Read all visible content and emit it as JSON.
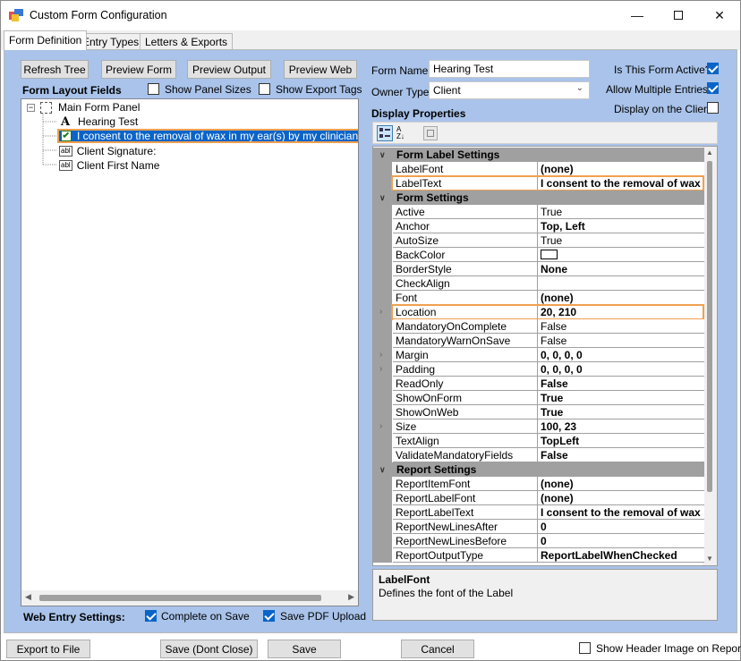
{
  "window": {
    "title": "Custom Form Configuration"
  },
  "tabs": [
    "Form Definition",
    "Entry Types",
    "Letters & Exports"
  ],
  "toolbar": {
    "refresh_tree": "Refresh Tree",
    "preview_form": "Preview Form",
    "preview_output": "Preview Output",
    "preview_web": "Preview Web"
  },
  "layout": {
    "heading": "Form Layout Fields",
    "show_panel_sizes": "Show Panel Sizes",
    "show_export_tags": "Show Export Tags",
    "tree": [
      {
        "label": "Main Form Panel",
        "icon": "panel-icon"
      },
      {
        "label": "Hearing Test",
        "icon": "label-a-icon"
      },
      {
        "label": "I consent to the removal of wax in my ear(s) by my clinician (if applic",
        "icon": "checkbox-icon"
      },
      {
        "label": "Client Signature:",
        "icon": "textbox-icon"
      },
      {
        "label": "Client First Name",
        "icon": "textbox-icon"
      }
    ]
  },
  "form": {
    "name_label": "Form Name",
    "name_value": "Hearing Test",
    "owner_label": "Owner Type",
    "owner_value": "Client",
    "active_label": "Is This Form Active?",
    "active": true,
    "multiple_label": "Allow Multiple Entries?",
    "multiple": true,
    "client_label": "Display on the Client",
    "client": false
  },
  "display": {
    "heading": "Display Properties",
    "props": [
      {
        "type": "cat",
        "name": "Form Label Settings"
      },
      {
        "name": "LabelFont",
        "value": "(none)",
        "bold": true
      },
      {
        "name": "LabelText",
        "value": "I consent to the removal of wax",
        "bold": true
      },
      {
        "type": "cat",
        "name": "Form Settings"
      },
      {
        "name": "Active",
        "value": "True"
      },
      {
        "name": "Anchor",
        "value": "Top, Left",
        "bold": true
      },
      {
        "name": "AutoSize",
        "value": "True"
      },
      {
        "name": "BackColor",
        "value": "",
        "swatch": "#ffffff"
      },
      {
        "name": "BorderStyle",
        "value": "None",
        "bold": true
      },
      {
        "name": "CheckAlign",
        "value": ""
      },
      {
        "name": "Font",
        "value": "(none)",
        "bold": true
      },
      {
        "name": "Location",
        "value": "20, 210",
        "bold": true,
        "expand": true
      },
      {
        "name": "MandatoryOnComplete",
        "value": "False"
      },
      {
        "name": "MandatoryWarnOnSave",
        "value": "False"
      },
      {
        "name": "Margin",
        "value": "0, 0, 0, 0",
        "bold": true,
        "expand": true
      },
      {
        "name": "Padding",
        "value": "0, 0, 0, 0",
        "bold": true,
        "expand": true
      },
      {
        "name": "ReadOnly",
        "value": "False",
        "bold": true
      },
      {
        "name": "ShowOnForm",
        "value": "True",
        "bold": true
      },
      {
        "name": "ShowOnWeb",
        "value": "True",
        "bold": true
      },
      {
        "name": "Size",
        "value": "100, 23",
        "bold": true,
        "expand": true
      },
      {
        "name": "TextAlign",
        "value": "TopLeft",
        "bold": true
      },
      {
        "name": "ValidateMandatoryFields",
        "value": "False",
        "bold": true
      },
      {
        "type": "cat",
        "name": "Report Settings"
      },
      {
        "name": "ReportItemFont",
        "value": "(none)",
        "bold": true
      },
      {
        "name": "ReportLabelFont",
        "value": "(none)",
        "bold": true
      },
      {
        "name": "ReportLabelText",
        "value": "I consent to the removal of wax",
        "bold": true
      },
      {
        "name": "ReportNewLinesAfter",
        "value": "0",
        "bold": true
      },
      {
        "name": "ReportNewLinesBefore",
        "value": "0",
        "bold": true
      },
      {
        "name": "ReportOutputType",
        "value": "ReportLabelWhenChecked",
        "bold": true
      }
    ],
    "desc_title": "LabelFont",
    "desc_text": "Defines the font of the Label"
  },
  "web": {
    "heading": "Web Entry Settings:",
    "complete_on_save": "Complete on Save",
    "save_pdf_upload": "Save PDF Upload"
  },
  "bottom": {
    "export": "Export to File",
    "save_dont_close": "Save (Dont Close)",
    "save": "Save",
    "cancel": "Cancel",
    "show_header": "Show Header Image on Report?"
  },
  "colors": {
    "panel_bg": "#a9c3ea",
    "highlight": "#f0a050",
    "selection": "#0a64c8"
  }
}
